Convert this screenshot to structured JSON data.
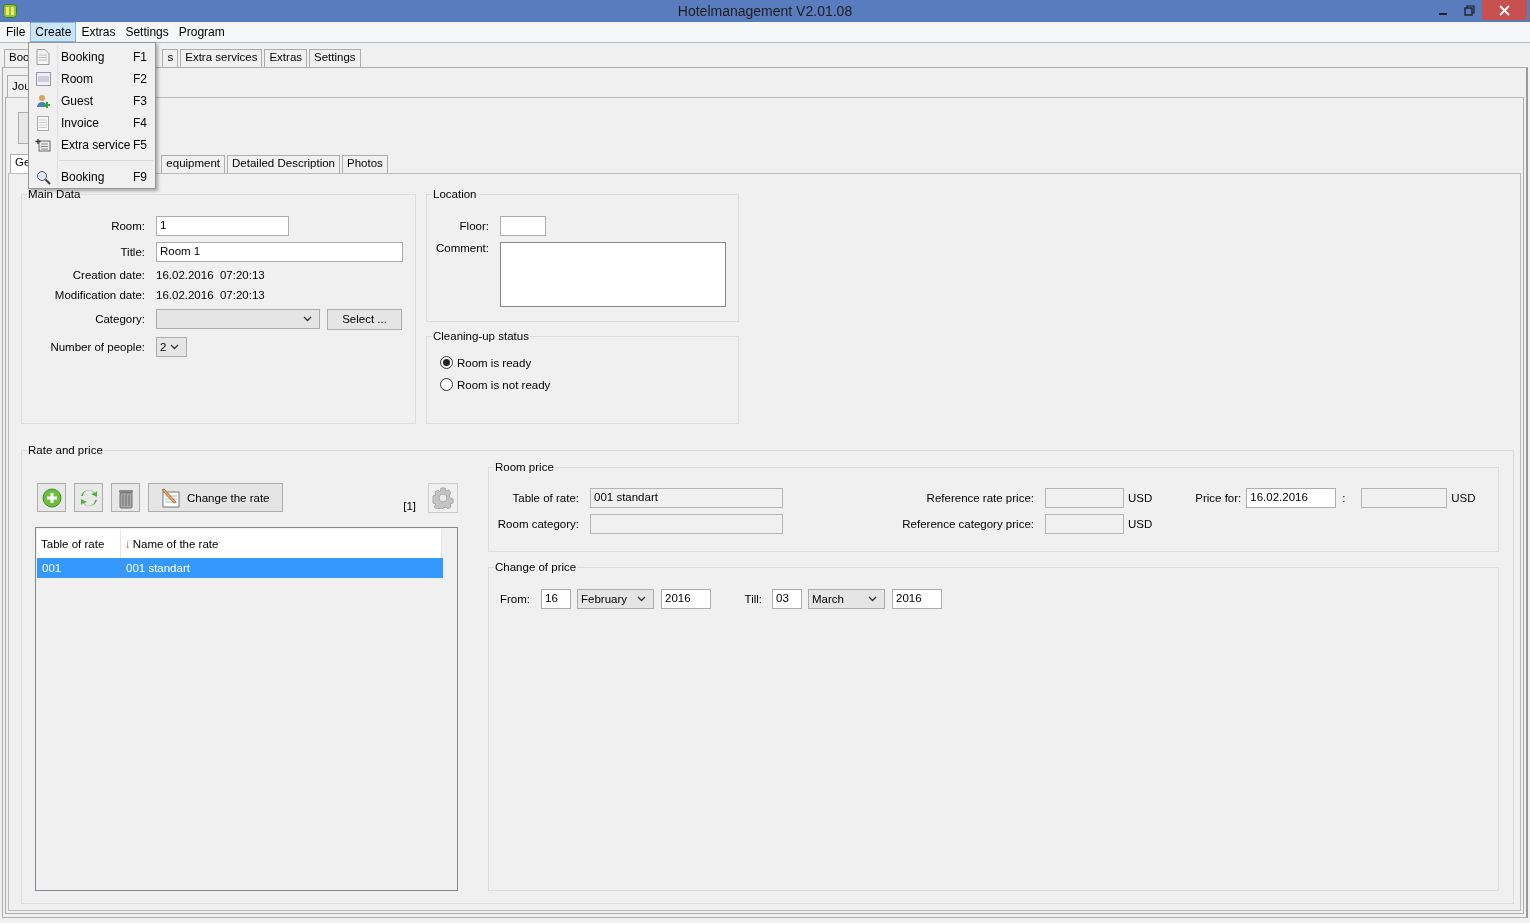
{
  "window": {
    "title": "Hotelmanagement V2.01.08"
  },
  "menu_bar": [
    {
      "label": "File",
      "selected": false
    },
    {
      "label": "Create",
      "selected": true
    },
    {
      "label": "Extras",
      "selected": false
    },
    {
      "label": "Settings",
      "selected": false
    },
    {
      "label": "Program",
      "selected": false
    }
  ],
  "create_menu": [
    {
      "label": "Booking",
      "shortcut": "F1",
      "separator_before": false
    },
    {
      "label": "Room",
      "shortcut": "F2",
      "separator_before": false
    },
    {
      "label": "Guest",
      "shortcut": "F3",
      "separator_before": false
    },
    {
      "label": "Invoice",
      "shortcut": "F4",
      "separator_before": false
    },
    {
      "label": "Extra service",
      "shortcut": "F5",
      "separator_before": false
    },
    {
      "label": "Booking",
      "shortcut": "F9",
      "separator_before": true
    }
  ],
  "main_tabs": [
    {
      "label": "Boo",
      "selected": false
    },
    {
      "label": "s",
      "selected": false
    },
    {
      "label": "Extra services",
      "selected": false
    },
    {
      "label": "Extras",
      "selected": false
    },
    {
      "label": "Settings",
      "selected": false
    }
  ],
  "sub_tabs": [
    {
      "label": "Jou",
      "selected": false
    }
  ],
  "detail_tabs": [
    {
      "label": "Ge",
      "selected": true
    },
    {
      "label": "equipment",
      "selected": false
    },
    {
      "label": "Detailed Description",
      "selected": false
    },
    {
      "label": "Photos",
      "selected": false
    }
  ],
  "main_data": {
    "title": "Main Data",
    "room": {
      "label": "Room:",
      "value": "1"
    },
    "title_field": {
      "label": "Title:",
      "value": "Room 1"
    },
    "creation_date": {
      "label": "Creation date:",
      "value": "16.02.2016  07:20:13"
    },
    "modification_date": {
      "label": "Modification date:",
      "value": "16.02.2016  07:20:13"
    },
    "category": {
      "label": "Category:"
    },
    "select_button": "Select ...",
    "number_of_people": {
      "label": "Number of people:",
      "value": "2"
    }
  },
  "location": {
    "title": "Location",
    "floor": {
      "label": "Floor:"
    },
    "comment": {
      "label": "Comment:"
    }
  },
  "cleaning_status": {
    "title": "Cleaning-up status",
    "options": [
      {
        "label": "Room is ready",
        "selected": true
      },
      {
        "label": "Room is not ready",
        "selected": false
      }
    ]
  },
  "rate_and_price": {
    "title": "Rate and price",
    "change_rate_button": "Change the rate",
    "count": "[1]",
    "settings_button": {
      "disabled": true
    },
    "rates_table": {
      "columns": [
        "Table of rate",
        "Name of the rate"
      ],
      "sort_arrow": "↓",
      "rows": [
        {
          "cells": [
            "001",
            "001 standart"
          ],
          "selected": true
        }
      ]
    },
    "room_price": {
      "title": "Room price",
      "table_of_rate": {
        "label": "Table of rate:",
        "value": "001 standart"
      },
      "room_category": {
        "label": "Room category:"
      },
      "reference_rate_price": {
        "label": "Reference rate price:",
        "unit": "USD"
      },
      "reference_category_price": {
        "label": "Reference category price:",
        "unit": "USD"
      },
      "price_for": {
        "label": "Price for:",
        "value": "16.02.2016",
        "separator": ":",
        "unit": "USD"
      }
    },
    "change_of_price": {
      "title": "Change of price",
      "from": {
        "label": "From:",
        "day": "16",
        "month": "February",
        "year": "2016"
      },
      "till": {
        "label": "Till:",
        "day": "03",
        "month": "March",
        "year": "2016"
      }
    }
  }
}
